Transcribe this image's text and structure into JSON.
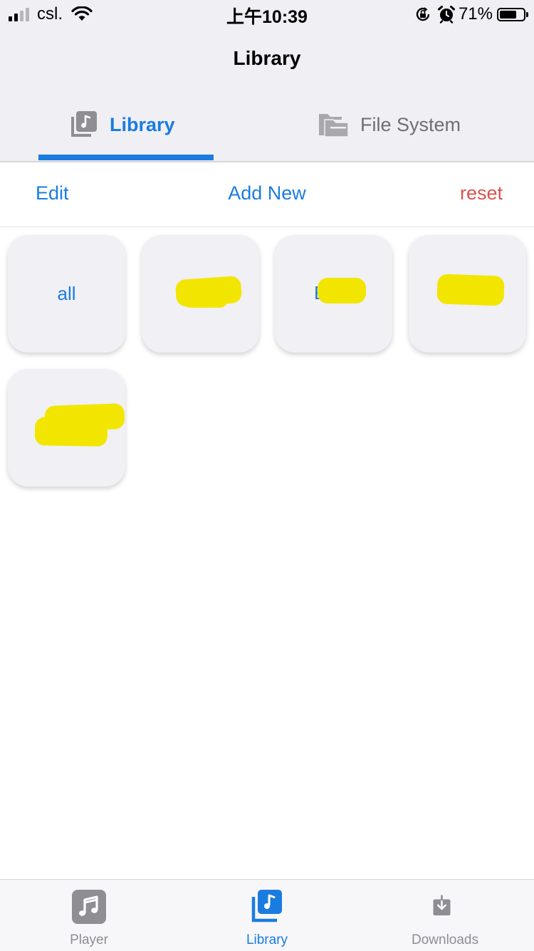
{
  "status_bar": {
    "carrier": "csl.",
    "time": "上午10:39",
    "battery_percent": "71%",
    "battery_level": 0.71,
    "signal_bars": 2,
    "icons": [
      "signal-icon",
      "wifi-icon",
      "orientation-lock-icon",
      "alarm-icon",
      "battery-icon"
    ]
  },
  "nav": {
    "title": "Library"
  },
  "segment_tabs": {
    "items": [
      {
        "label": "Library",
        "icon": "music-library-icon",
        "selected": true
      },
      {
        "label": "File System",
        "icon": "folders-icon",
        "selected": false
      }
    ]
  },
  "actions": {
    "edit": "Edit",
    "add_new": "Add New",
    "reset": "reset"
  },
  "categories": [
    {
      "label": "all",
      "redacted": false
    },
    {
      "label": "",
      "redacted": true
    },
    {
      "label": "E",
      "redacted": true
    },
    {
      "label": "",
      "redacted": true
    },
    {
      "label": "",
      "redacted": true
    }
  ],
  "tab_bar": {
    "items": [
      {
        "label": "Player",
        "icon": "music-note-icon",
        "active": false
      },
      {
        "label": "Library",
        "icon": "music-library-icon",
        "active": true
      },
      {
        "label": "Downloads",
        "icon": "download-icon",
        "active": false
      }
    ]
  },
  "colors": {
    "accent": "#1a7ce0",
    "destructive": "#d9534f",
    "inactive": "#8e8e93",
    "header_background": "#efeff4",
    "redaction": "#f2e600"
  }
}
